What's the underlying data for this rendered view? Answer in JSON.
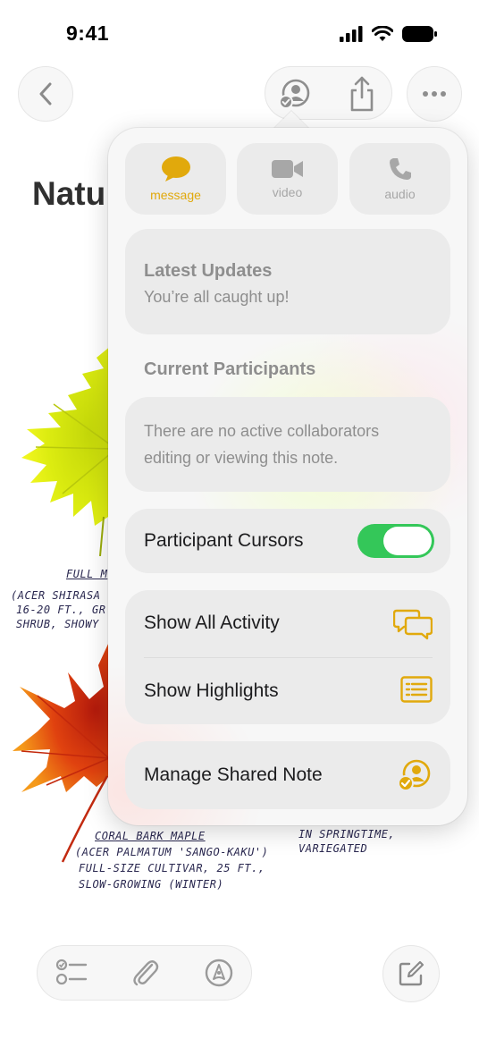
{
  "status_bar": {
    "time": "9:41"
  },
  "note": {
    "title": "Natu",
    "label1_title": "FULL M",
    "label1_lines": [
      "(ACER SHIRASA",
      "16-20 FT., GR",
      "SHRUB, SHOWY"
    ],
    "label2_title": "CORAL BARK MAPLE",
    "label2_lines": [
      "(ACER PALMATUM 'SANGO-KAKU')",
      "FULL-SIZE CULTIVAR, 25 FT.,",
      "SLOW-GROWING (WINTER)"
    ],
    "label3_lines": [
      "IN SPRINGTIME,",
      "VARIEGATED"
    ]
  },
  "popover": {
    "communication": [
      {
        "label": "message",
        "icon": "message-icon",
        "active": true
      },
      {
        "label": "video",
        "icon": "video-icon",
        "active": false
      },
      {
        "label": "audio",
        "icon": "phone-icon",
        "active": false
      }
    ],
    "updates": {
      "title": "Latest Updates",
      "subtitle": "You’re all caught up!"
    },
    "participants": {
      "heading": "Current Participants",
      "empty_line1": "There are no active collaborators",
      "empty_line2": "editing or viewing this note."
    },
    "cursors": {
      "label": "Participant Cursors",
      "enabled": true
    },
    "activity": {
      "show_all": "Show All Activity",
      "show_highlights": "Show Highlights"
    },
    "manage": {
      "label": "Manage Shared Note"
    },
    "accent_color": "#e1a90c",
    "toggle_color": "#34c759"
  }
}
